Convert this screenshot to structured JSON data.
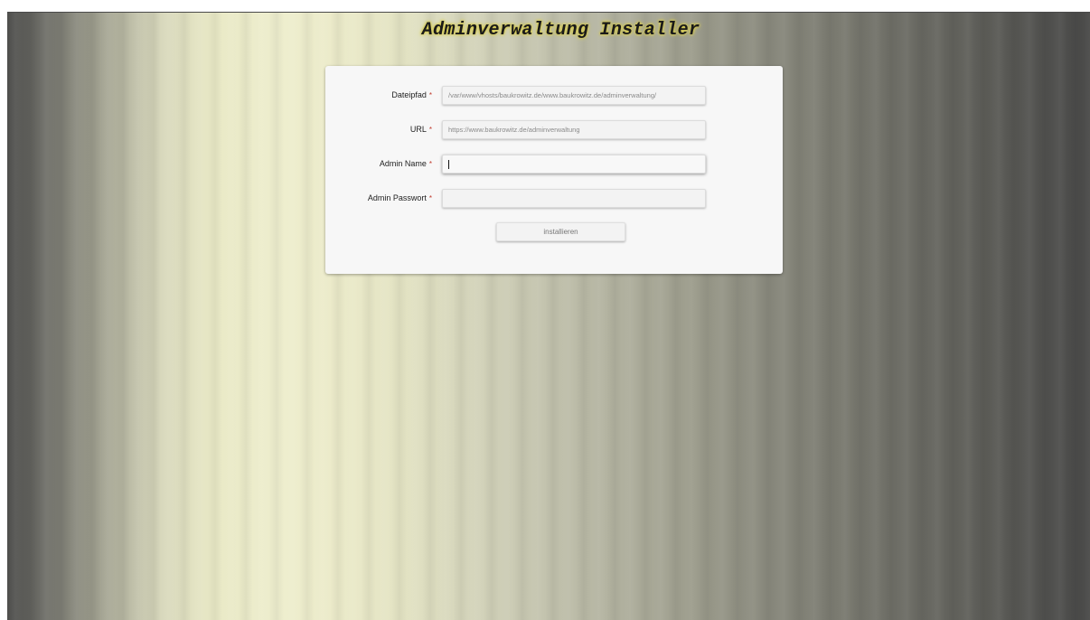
{
  "page": {
    "title": "Adminverwaltung Installer"
  },
  "form": {
    "fields": [
      {
        "label": "Dateipfad",
        "required_marker": "*",
        "value": "/var/www/vhosts/baukrowitz.de/www.baukrowitz.de/adminverwaltung/",
        "state": "filled"
      },
      {
        "label": "URL",
        "required_marker": "*",
        "value": "https://www.baukrowitz.de/adminverwaltung",
        "state": "filled"
      },
      {
        "label": "Admin Name",
        "required_marker": "*",
        "value": "",
        "state": "focused"
      },
      {
        "label": "Admin Passwort",
        "required_marker": "*",
        "value": "",
        "state": "empty"
      }
    ],
    "submit_label": "installieren"
  },
  "colors": {
    "required_marker": "#c0392b",
    "title_glow": "#d4c84a",
    "card_background": "#f7f7f7"
  }
}
